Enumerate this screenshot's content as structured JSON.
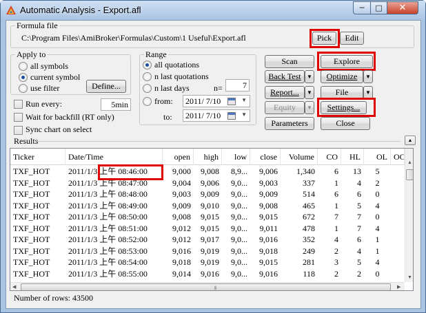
{
  "window": {
    "title": "Automatic Analysis - Export.afl",
    "min_glyph": "─",
    "max_glyph": "□",
    "close_glyph": "✕"
  },
  "formula": {
    "label": "Formula file",
    "path": "C:\\Program Files\\AmiBroker\\Formulas\\Custom\\1 Useful\\Export.afl",
    "pick_label": "Pick",
    "edit_label": "Edit"
  },
  "apply_to": {
    "label": "Apply to",
    "options": [
      "all symbols",
      "current symbol",
      "use filter"
    ],
    "selected": "current symbol",
    "define_label": "Define..."
  },
  "range": {
    "label": "Range",
    "options": [
      "all quotations",
      "n last quotations",
      "n last days",
      "from:"
    ],
    "selected": "all quotations",
    "n_label": "n=",
    "n_value": "7",
    "to_label": "to:",
    "from_date": "2011/  7/10",
    "to_date": "2011/  7/10"
  },
  "options": {
    "run_every_label": "Run every:",
    "run_every_value": "5min",
    "wait_backfill_label": "Wait for backfill (RT only)",
    "sync_chart_label": "Sync chart on select"
  },
  "buttons": {
    "scan": "Scan",
    "explore": "Explore",
    "back_test": "Back Test",
    "optimize": "Optimize",
    "report": "Report...",
    "file": "File",
    "equity": "Equity",
    "settings": "Settings...",
    "parameters": "Parameters",
    "close": "Close"
  },
  "results": {
    "label": "Results",
    "columns": [
      "Ticker",
      "Date/Time",
      "open",
      "high",
      "low",
      "close",
      "Volume",
      "CO",
      "HL",
      "OL",
      "OC"
    ],
    "rows": [
      [
        "TXF_HOT",
        "2011/1/3 上午 08:46:00",
        "9,000",
        "9,008",
        "8,9...",
        "9,006",
        "1,340",
        "6",
        "13",
        "5",
        ""
      ],
      [
        "TXF_HOT",
        "2011/1/3 上午 08:47:00",
        "9,004",
        "9,006",
        "9,0...",
        "9,003",
        "337",
        "1",
        "4",
        "2",
        ""
      ],
      [
        "TXF_HOT",
        "2011/1/3 上午 08:48:00",
        "9,003",
        "9,009",
        "9,0...",
        "9,009",
        "514",
        "6",
        "6",
        "0",
        ""
      ],
      [
        "TXF_HOT",
        "2011/1/3 上午 08:49:00",
        "9,009",
        "9,010",
        "9,0...",
        "9,008",
        "465",
        "1",
        "5",
        "4",
        ""
      ],
      [
        "TXF_HOT",
        "2011/1/3 上午 08:50:00",
        "9,008",
        "9,015",
        "9,0...",
        "9,015",
        "672",
        "7",
        "7",
        "0",
        ""
      ],
      [
        "TXF_HOT",
        "2011/1/3 上午 08:51:00",
        "9,012",
        "9,015",
        "9,0...",
        "9,011",
        "478",
        "1",
        "7",
        "4",
        ""
      ],
      [
        "TXF_HOT",
        "2011/1/3 上午 08:52:00",
        "9,012",
        "9,017",
        "9,0...",
        "9,016",
        "352",
        "4",
        "6",
        "1",
        ""
      ],
      [
        "TXF_HOT",
        "2011/1/3 上午 08:53:00",
        "9,016",
        "9,019",
        "9,0...",
        "9,018",
        "249",
        "2",
        "4",
        "1",
        ""
      ],
      [
        "TXF_HOT",
        "2011/1/3 上午 08:54:00",
        "9,018",
        "9,019",
        "9,0...",
        "9,015",
        "281",
        "3",
        "5",
        "4",
        ""
      ],
      [
        "TXF_HOT",
        "2011/1/3 上午 08:55:00",
        "9,014",
        "9,016",
        "9,0...",
        "9,016",
        "118",
        "2",
        "2",
        "0",
        ""
      ]
    ],
    "row_count_label": "Number of rows: 43500"
  }
}
